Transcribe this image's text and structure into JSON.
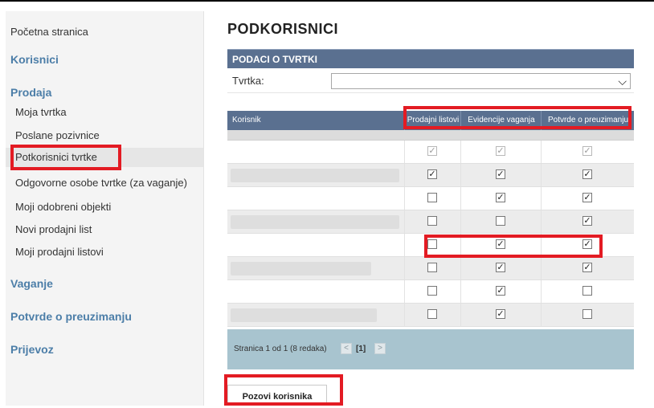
{
  "sidebar": {
    "home": "Početna stranica",
    "sections": [
      {
        "label": "Korisnici"
      },
      {
        "label": "Prodaja"
      },
      {
        "label": "Vaganje"
      },
      {
        "label": "Potvrde o preuzimanju"
      },
      {
        "label": "Prijevoz"
      }
    ],
    "items": [
      {
        "label": "Moja tvrtka"
      },
      {
        "label": "Poslane pozivnice"
      },
      {
        "label": "Potkorisnici tvrtke"
      },
      {
        "label": "Odgovorne osobe tvrtke (za vaganje)"
      },
      {
        "label": "Moji odobreni objekti"
      },
      {
        "label": "Novi prodajni list"
      },
      {
        "label": "Moji prodajni listovi"
      }
    ],
    "active_item": "Potkorisnici tvrtke"
  },
  "main": {
    "title": "PODKORISNICI",
    "company_panel": {
      "header": "PODACI O TVRTKI",
      "label": "Tvrtka:",
      "value": ""
    },
    "grid": {
      "columns": [
        "Korisnik",
        "Prodajni listovi",
        "Evidencije vaganja",
        "Potvrde o preuzimanju"
      ],
      "rows": [
        {
          "checks": [
            true,
            true,
            true
          ],
          "disabled": true
        },
        {
          "checks": [
            true,
            true,
            true
          ],
          "disabled": false
        },
        {
          "checks": [
            false,
            true,
            true
          ],
          "disabled": false
        },
        {
          "checks": [
            false,
            false,
            true
          ],
          "disabled": false
        },
        {
          "checks": [
            false,
            true,
            true
          ],
          "disabled": false
        },
        {
          "checks": [
            false,
            true,
            true
          ],
          "disabled": false
        },
        {
          "checks": [
            false,
            true,
            false
          ],
          "disabled": false
        },
        {
          "checks": [
            false,
            true,
            false
          ],
          "disabled": false
        }
      ]
    },
    "pager": {
      "text": "Stranica 1 od 1 (8 redaka)",
      "current": "[1]",
      "prev": "<",
      "next": ">"
    },
    "invite_button": "Pozovi korisnika"
  },
  "colors": {
    "section": "#4c7ea8",
    "header": "#5a7090",
    "pager": "#a8c4cf",
    "highlight": "#e31b23"
  }
}
